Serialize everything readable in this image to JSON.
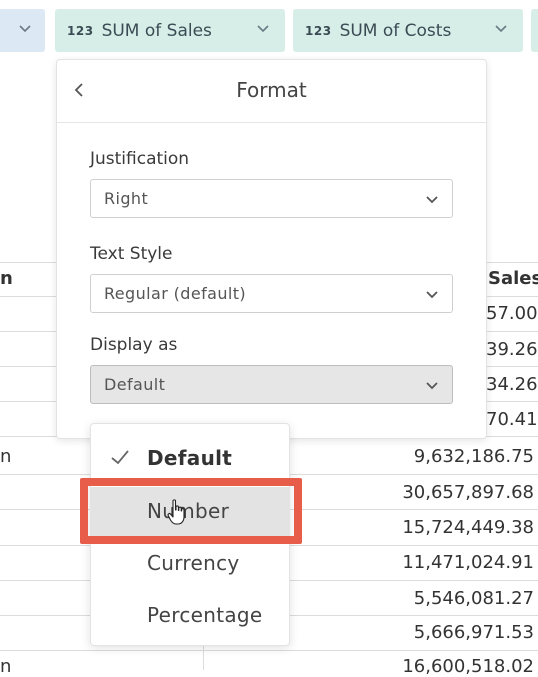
{
  "pills": [
    {
      "type_label": "",
      "label": ""
    },
    {
      "type_label": "123",
      "label": "SUM of Sales"
    },
    {
      "type_label": "123",
      "label": "SUM of Costs"
    }
  ],
  "table": {
    "left_header_fragment": "n",
    "right_header_fragment": "Sales",
    "left_fragments": [
      "n",
      "n"
    ],
    "hidden_values": [
      "57.00",
      "39.26",
      "34.26",
      "70.41"
    ],
    "values": [
      "9,632,186.75",
      "30,657,897.68",
      "15,724,449.38",
      "11,471,024.91",
      "5,546,081.27",
      "5,666,971.53",
      "16,600,518.02"
    ]
  },
  "format_panel": {
    "title": "Format",
    "justification": {
      "label": "Justification",
      "value": "Right"
    },
    "text_style": {
      "label": "Text Style",
      "value": "Regular (default)"
    },
    "display_as": {
      "label": "Display as",
      "value": "Default"
    }
  },
  "display_menu": {
    "options": [
      "Default",
      "Number",
      "Currency",
      "Percentage"
    ],
    "selected": "Default",
    "hovered": "Number"
  },
  "colors": {
    "pill_green": "#d7eee8",
    "pill_blue": "#dde8f5",
    "highlight": "#e85d4a"
  },
  "icons": [
    "chevron-down-icon",
    "chevron-left-icon",
    "checkmark-icon",
    "hand-cursor-icon"
  ]
}
